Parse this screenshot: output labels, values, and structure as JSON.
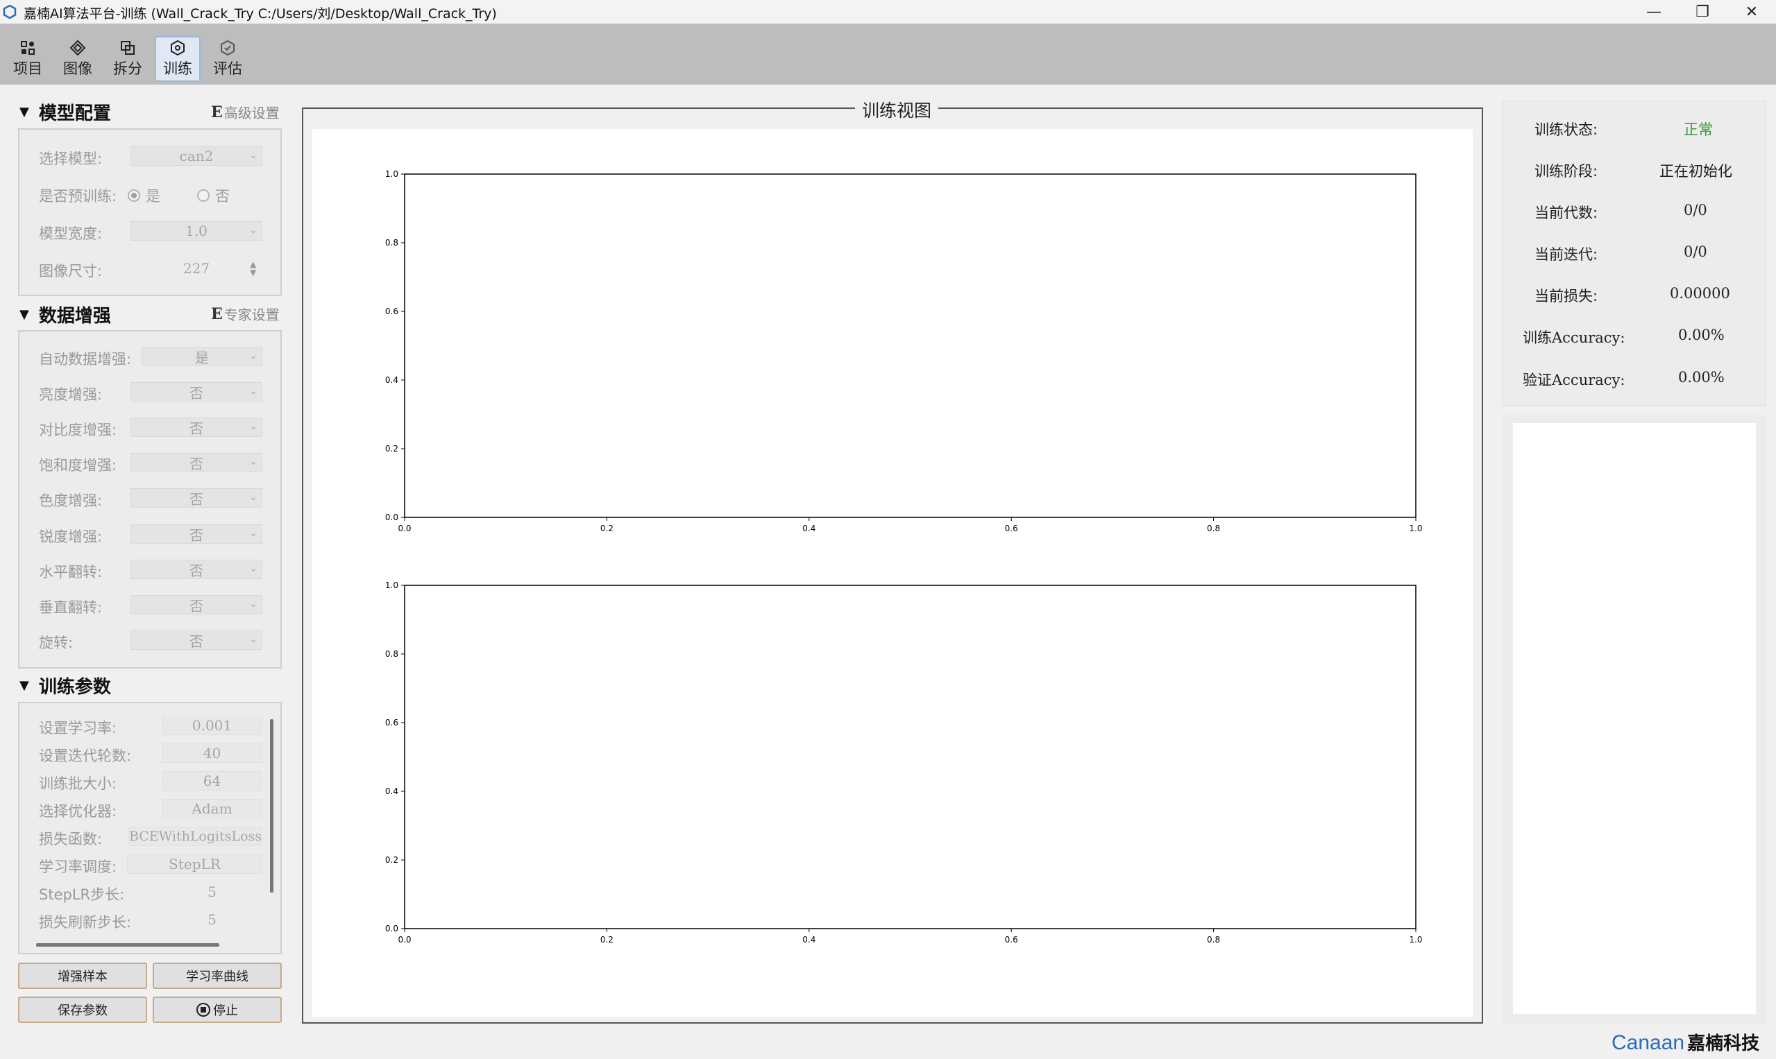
{
  "window": {
    "title": "嘉楠AI算法平台-训练 (Wall_Crack_Try  C:/Users/刘/Desktop/Wall_Crack_Try)",
    "minimize": "—",
    "maximize": "❐",
    "close": "✕"
  },
  "toolbar": {
    "items": [
      {
        "label": "项目",
        "icon": "project-grid-icon"
      },
      {
        "label": "图像",
        "icon": "image-diamond-icon"
      },
      {
        "label": "拆分",
        "icon": "split-icon"
      },
      {
        "label": "训练",
        "icon": "train-icon",
        "active": true
      },
      {
        "label": "评估",
        "icon": "evaluate-icon"
      }
    ]
  },
  "model_config": {
    "title": "模型配置",
    "link_icon": "E",
    "link": "高级设置",
    "select_model_label": "选择模型:",
    "select_model_value": "can2",
    "pretrain_label": "是否预训练:",
    "pretrain_yes": "是",
    "pretrain_no": "否",
    "pretrain_selected": "是",
    "width_label": "模型宽度:",
    "width_value": "1.0",
    "size_label": "图像尺寸:",
    "size_value": "227"
  },
  "augmentation": {
    "title": "数据增强",
    "link_icon": "E",
    "link": "专家设置",
    "fields": [
      {
        "label": "自动数据增强:",
        "value": "是"
      },
      {
        "label": "亮度增强:",
        "value": "否"
      },
      {
        "label": "对比度增强:",
        "value": "否"
      },
      {
        "label": "饱和度增强:",
        "value": "否"
      },
      {
        "label": "色度增强:",
        "value": "否"
      },
      {
        "label": "锐度增强:",
        "value": "否"
      },
      {
        "label": "水平翻转:",
        "value": "否"
      },
      {
        "label": "垂直翻转:",
        "value": "否"
      },
      {
        "label": "旋转:",
        "value": "否"
      }
    ]
  },
  "train_params": {
    "title": "训练参数",
    "fields": [
      {
        "label": "设置学习率:",
        "value": "0.001"
      },
      {
        "label": "设置迭代轮数:",
        "value": "40"
      },
      {
        "label": "训练批大小:",
        "value": "64"
      },
      {
        "label": "选择优化器:",
        "value": "Adam"
      },
      {
        "label": "损失函数:",
        "value": "BCEWithLogitsLoss"
      },
      {
        "label": "学习率调度:",
        "value": "StepLR"
      },
      {
        "label": "StepLR步长:",
        "value": "5"
      },
      {
        "label": "损失刷新步长:",
        "value": "5"
      }
    ]
  },
  "buttons": {
    "augment_sample": "增强样本",
    "lr_curve": "学习率曲线",
    "save_params": "保存参数",
    "stop": "停止"
  },
  "train_view": {
    "title": "训练视图"
  },
  "chart_data": [
    {
      "type": "line",
      "title": "",
      "xlabel": "",
      "ylabel": "",
      "xlim": [
        0.0,
        1.0
      ],
      "ylim": [
        0.0,
        1.0
      ],
      "xticks": [
        "0.0",
        "0.2",
        "0.4",
        "0.6",
        "0.8",
        "1.0"
      ],
      "yticks": [
        "0.0",
        "0.2",
        "0.4",
        "0.6",
        "0.8",
        "1.0"
      ],
      "series": [],
      "grid": false
    },
    {
      "type": "line",
      "title": "",
      "xlabel": "",
      "ylabel": "",
      "xlim": [
        0.0,
        1.0
      ],
      "ylim": [
        0.0,
        1.0
      ],
      "xticks": [
        "0.0",
        "0.2",
        "0.4",
        "0.6",
        "0.8",
        "1.0"
      ],
      "yticks": [
        "0.0",
        "0.2",
        "0.4",
        "0.6",
        "0.8",
        "1.0"
      ],
      "series": [],
      "grid": false
    }
  ],
  "status": {
    "rows": [
      {
        "label": "训练状态:",
        "value": "正常",
        "color": "#3a9a3a"
      },
      {
        "label": "训练阶段:",
        "value": "正在初始化"
      },
      {
        "label": "当前代数:",
        "value": "0/0"
      },
      {
        "label": "当前迭代:",
        "value": "0/0"
      },
      {
        "label": "当前损失:",
        "value": "0.00000"
      },
      {
        "label": "训练Accuracy:",
        "value": "0.00%"
      },
      {
        "label": "验证Accuracy:",
        "value": "0.00%"
      }
    ]
  },
  "brand": {
    "en": "Canaan",
    "cn": "嘉楠科技"
  }
}
